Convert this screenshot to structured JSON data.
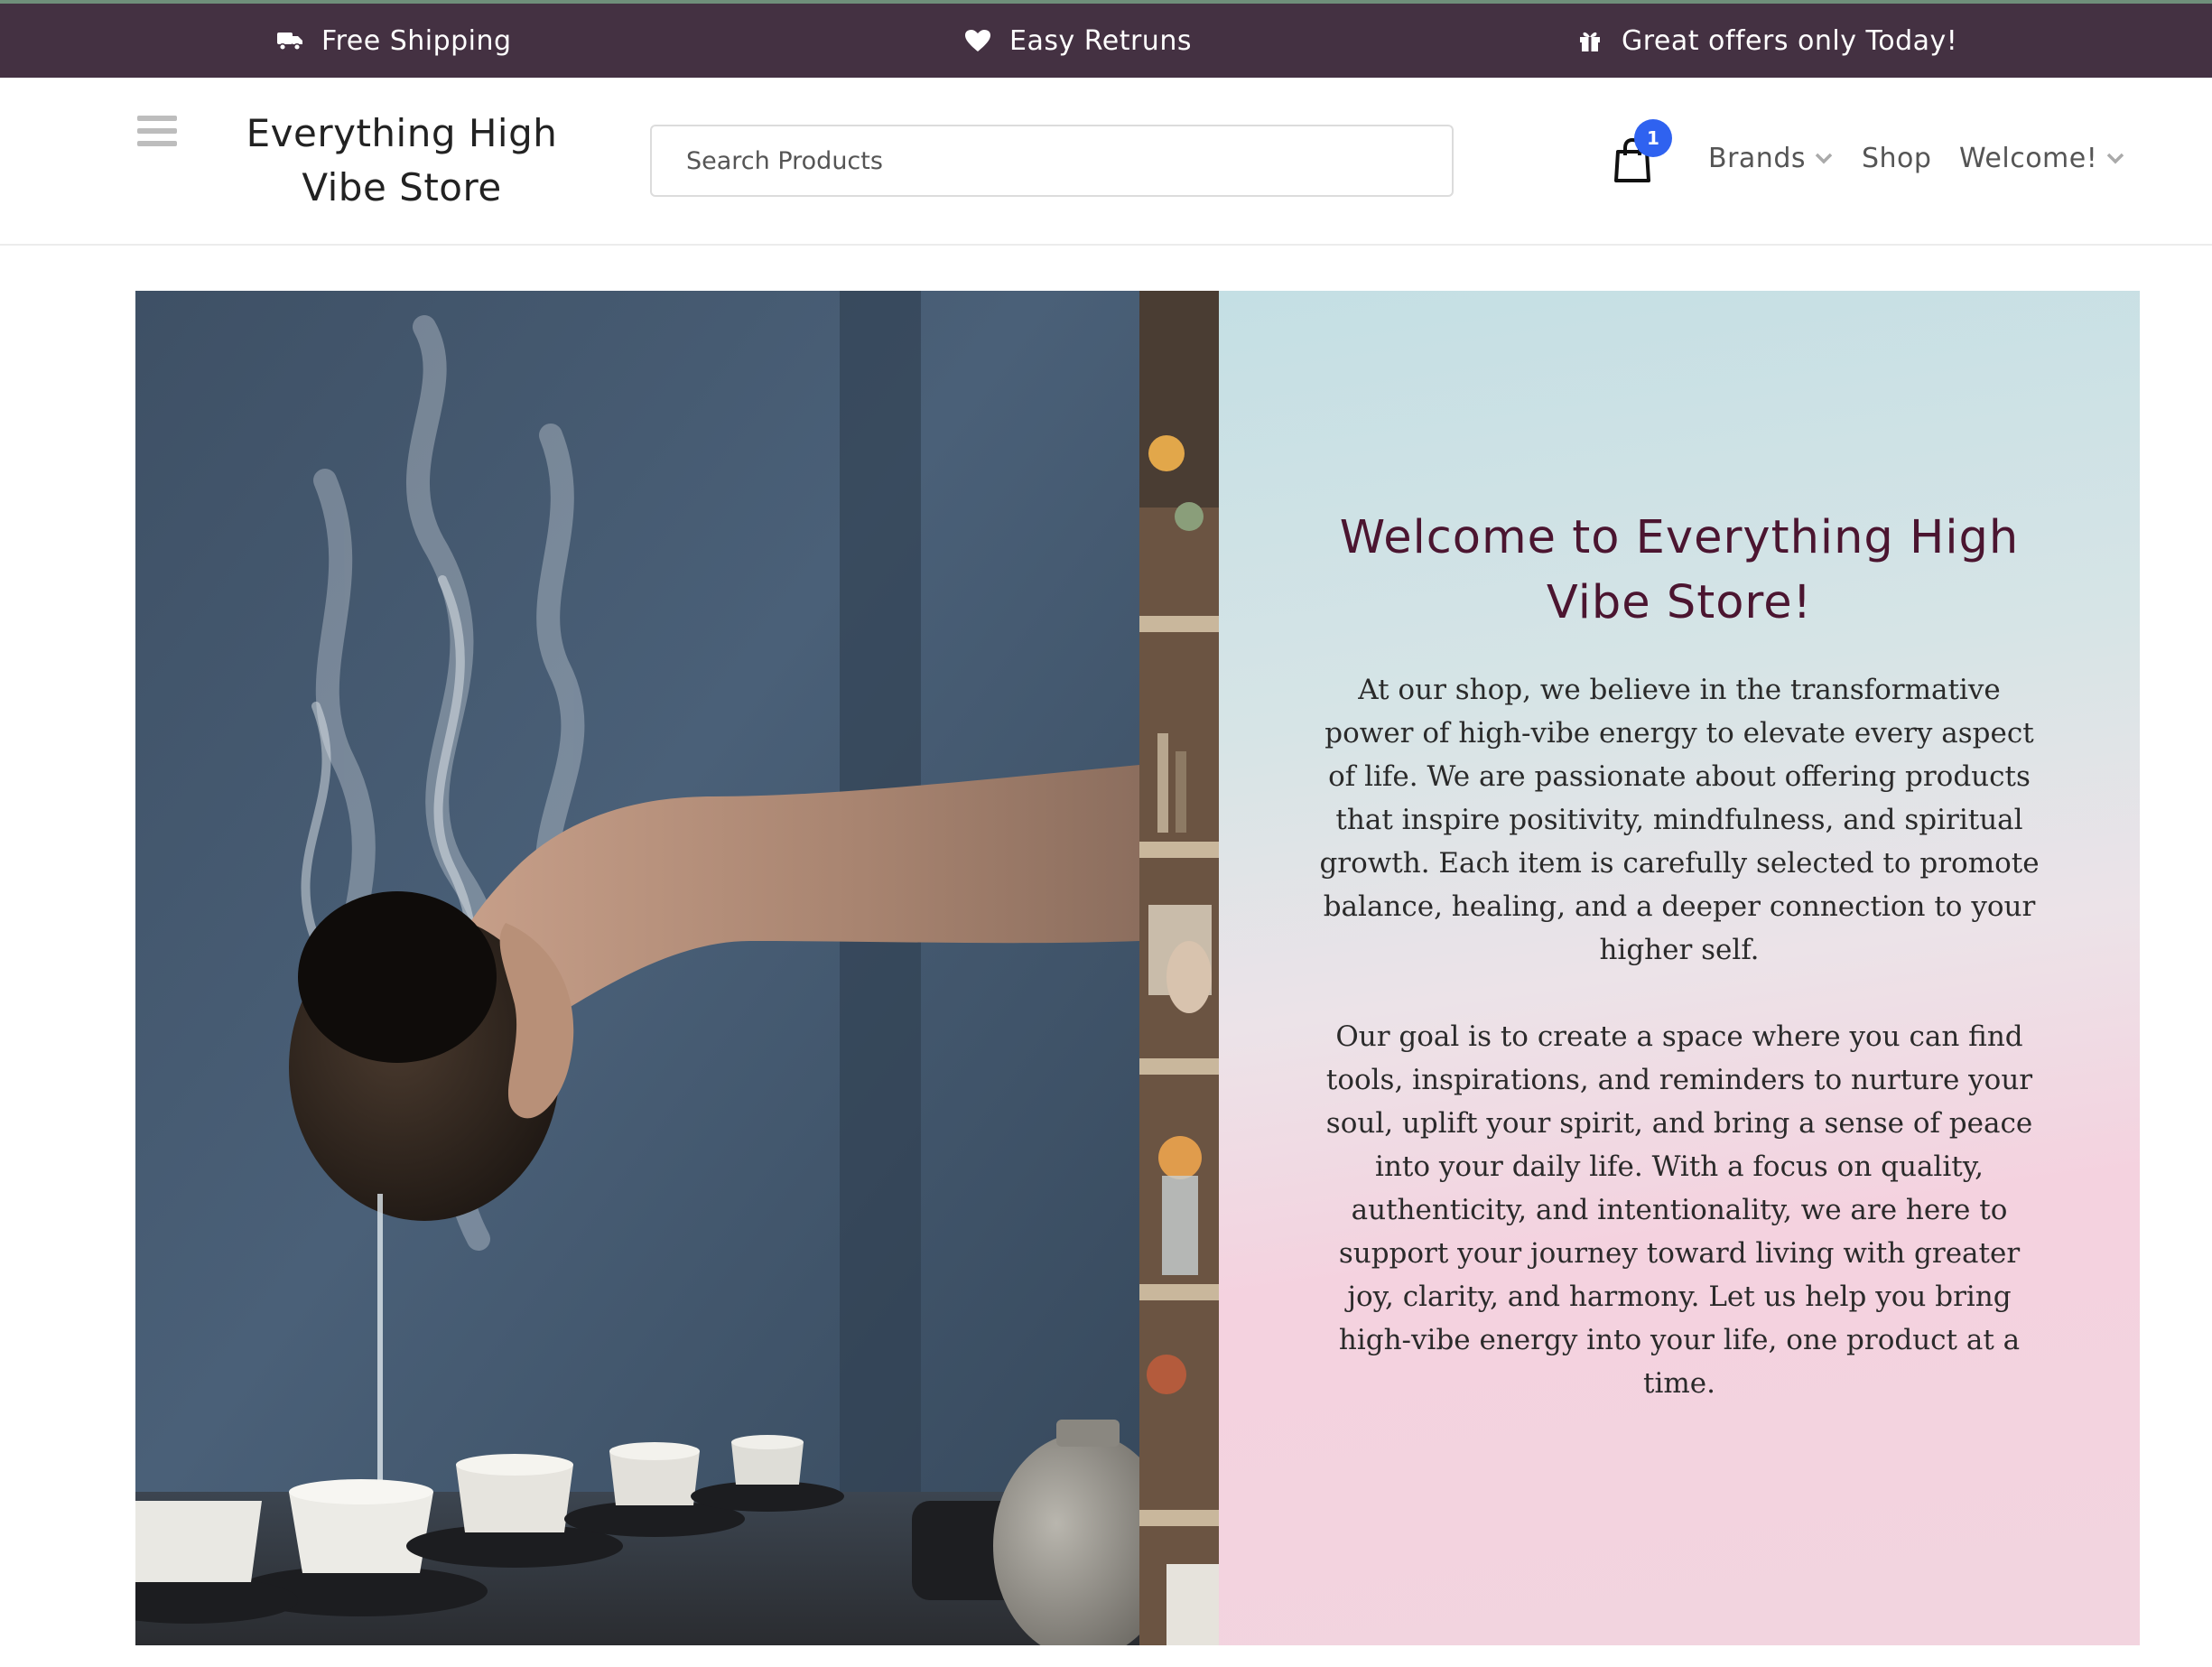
{
  "topbar": {
    "shipping": "Free Shipping",
    "returns": "Easy Retruns",
    "offers": "Great offers only Today!"
  },
  "header": {
    "store_name": "Everything High Vibe Store",
    "search_placeholder": "Search Products",
    "cart_count": "1",
    "nav": {
      "brands": "Brands",
      "shop": "Shop",
      "welcome": "Welcome!"
    }
  },
  "hero": {
    "title": "Welcome to Everything High Vibe Store!",
    "paragraph1": "At our shop, we believe in the transformative power of high-vibe energy to elevate every aspect of life. We are passionate about offering products that inspire positivity, mindfulness, and spiritual growth. Each item is carefully selected to promote balance, healing, and a deeper connection to your higher self.",
    "paragraph2": "Our goal is to create a space where you can find tools, inspirations, and reminders to nurture your soul, uplift your spirit, and bring a sense of peace into your daily life. With a focus on quality, authenticity, and intentionality, we are here to support your journey toward living with greater joy, clarity, and harmony. Let us help you bring high-vibe energy into your life, one product at a time."
  },
  "colors": {
    "topbar_bg": "#443142",
    "title_color": "#4b1530",
    "badge": "#2f62f0"
  },
  "icons": [
    "truck-icon",
    "heart-icon",
    "gift-icon",
    "hamburger-icon",
    "shopping-bag-icon",
    "chevron-down-icon"
  ]
}
